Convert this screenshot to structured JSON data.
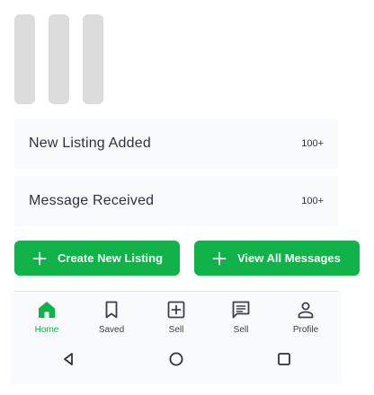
{
  "notifications": [
    {
      "label": "New Listing Added",
      "count": "100+"
    },
    {
      "label": "Message Received",
      "count": "100+"
    }
  ],
  "actions": {
    "create_label": "Create New Listing",
    "view_label": "View All Messages"
  },
  "bottom_nav": {
    "items": [
      {
        "label": "Home",
        "icon": "home-icon",
        "active": true
      },
      {
        "label": "Saved",
        "icon": "bookmark-icon",
        "active": false
      },
      {
        "label": "Sell",
        "icon": "add-box-icon",
        "active": false
      },
      {
        "label": "Sell",
        "icon": "message-icon",
        "active": false
      },
      {
        "label": "Profile",
        "icon": "person-icon",
        "active": false
      }
    ]
  },
  "system_nav": [
    "back-icon",
    "home-circle-icon",
    "recents-icon"
  ],
  "colors": {
    "accent": "#12b24a",
    "text": "#2c3340",
    "surface": "#f9fafb",
    "placeholder": "#dcdcdc"
  }
}
